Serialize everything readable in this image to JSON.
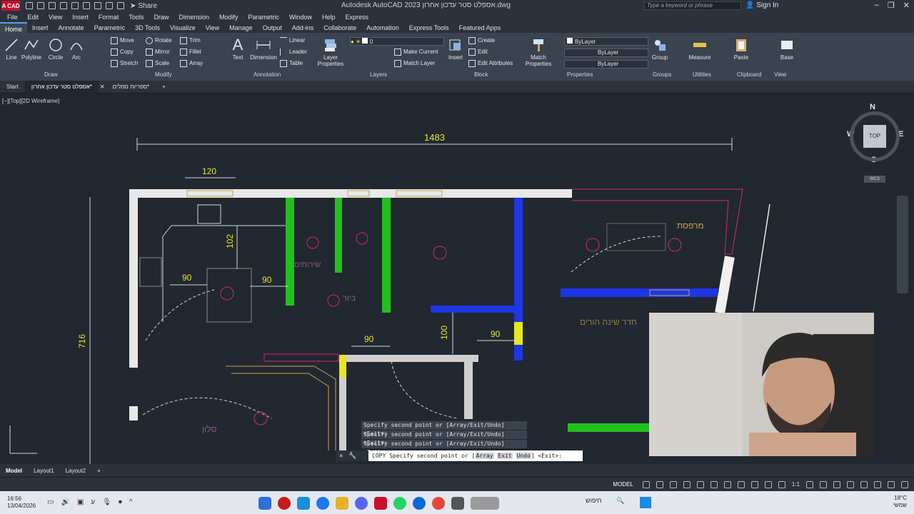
{
  "app": {
    "logo_text": "A CAD",
    "title": "Autodesk AutoCAD 2023   אספלט סטר עדכון אחרון.dwg",
    "share_label": "Share",
    "search_placeholder": "Type a keyword or phrase",
    "sign_in": "Sign In"
  },
  "menu": [
    "File",
    "Edit",
    "View",
    "Insert",
    "Format",
    "Tools",
    "Draw",
    "Dimension",
    "Modify",
    "Parametric",
    "Window",
    "Help",
    "Express"
  ],
  "ribbon_tabs": [
    "Home",
    "Insert",
    "Annotate",
    "Parametric",
    "3D Tools",
    "Visualize",
    "View",
    "Manage",
    "Output",
    "Add-ins",
    "Collaborate",
    "Automation",
    "Express Tools",
    "Featured Apps"
  ],
  "ribbon": {
    "draw": {
      "title": "Draw",
      "line": "Line",
      "polyline": "Polyline",
      "circle": "Circle",
      "arc": "Arc"
    },
    "modify": {
      "title": "Modify",
      "move": "Move",
      "rotate": "Rotate",
      "trim": "Trim",
      "copy": "Copy",
      "mirror": "Mirror",
      "fillet": "Fillet",
      "stretch": "Stretch",
      "scale": "Scale",
      "array": "Array"
    },
    "annotation": {
      "title": "Annotation",
      "text": "Text",
      "dimension": "Dimension",
      "linear": "Linear",
      "leader": "Leader",
      "table": "Table"
    },
    "layers": {
      "title": "Layers",
      "layer_properties": "Layer Properties",
      "current_layer": "0",
      "make_current": "Make Current",
      "match_layer": "Match Layer"
    },
    "block": {
      "title": "Block",
      "insert": "Insert",
      "create": "Create",
      "edit": "Edit",
      "edit_attributes": "Edit Attributes"
    },
    "properties": {
      "title": "Properties",
      "match": "Match Properties",
      "color": "ByLayer",
      "linetype": "ByLayer",
      "lineweight": "ByLayer"
    },
    "groups": {
      "title": "Groups",
      "group": "Group"
    },
    "utilities": {
      "title": "Utilities",
      "measure": "Measure"
    },
    "clipboard": {
      "title": "Clipboard",
      "paste": "Paste"
    },
    "view": {
      "title": "View",
      "base": "Base"
    }
  },
  "doc_tabs": [
    "Start",
    "אספלט סטר עדכון אחרון*",
    "ספריות סמלים*"
  ],
  "viewport": {
    "label": "[−][Top][2D Wireframe]",
    "compass": {
      "n": "N",
      "s": "S",
      "e": "E",
      "w": "W",
      "top": "TOP",
      "wcs": "WCS"
    },
    "dims": {
      "total_width": "1483",
      "width_120": "120",
      "height_102": "102",
      "w90a": "90",
      "w90b": "90",
      "w90c": "90",
      "w90d": "90",
      "h100": "100",
      "h716": "716"
    },
    "rooms": {
      "balcony": "מרפסת",
      "parents": "חדר שינה הורים",
      "salon": "סלון",
      "bath": "שירותים",
      "lobby": "ביור"
    }
  },
  "command": {
    "history": [
      "Specify second point or [Array/Exit/Undo] <Exit>:",
      "Specify second point or [Array/Exit/Undo] <Exit>:",
      "Specify second point or [Array/Exit/Undo] <Exit>:"
    ],
    "prompt_prefix": "COPY Specify second point or [",
    "kw1": "Array",
    "kw2": "Exit",
    "kw3": "Undo",
    "prompt_suffix": "] <Exit>:"
  },
  "layout_tabs": [
    "Model",
    "Layout1",
    "Layout2"
  ],
  "status": {
    "mode": "MODEL",
    "scale": "1:1"
  },
  "taskbar": {
    "time": "16:56",
    "date": "13/04/2026",
    "search": "חיפוש",
    "weather": "18°C",
    "weather_sub": "שמשי"
  },
  "colors": {
    "accent": "#5aa0e6",
    "green_wall": "#22c01e",
    "blue_wall": "#1e36e6",
    "magenta": "#d4267c",
    "yellow": "#e6e61e"
  }
}
